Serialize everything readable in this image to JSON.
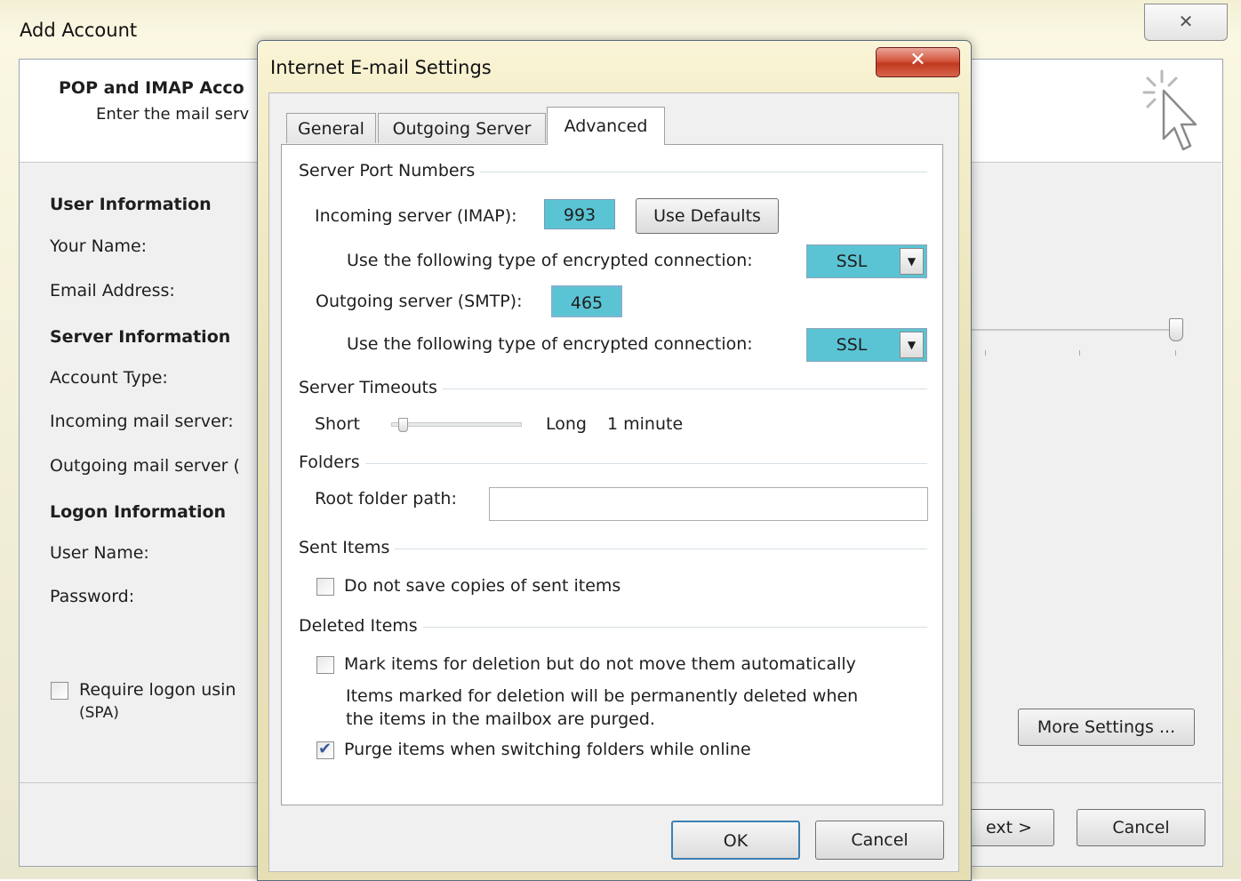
{
  "background_window": {
    "title": "Add Account",
    "close_glyph": "✕",
    "header": {
      "title": "POP and IMAP Acco",
      "subtitle": "Enter the mail serv"
    },
    "sections": {
      "user_info": "User Information",
      "server_info": "Server Information",
      "logon_info": "Logon Information"
    },
    "labels": {
      "your_name": "Your Name:",
      "email_address": "Email Address:",
      "account_type": "Account Type:",
      "incoming_server": "Incoming mail server:",
      "outgoing_server": "Outgoing mail server (",
      "user_name": "User Name:",
      "password": "Password:"
    },
    "require_logon": {
      "line1": "Require logon usin",
      "line2": "(SPA)",
      "checked": false
    },
    "buttons": {
      "more_settings": "More Settings ...",
      "next": "ext >",
      "cancel": "Cancel"
    }
  },
  "dialog": {
    "title": "Internet E-mail Settings",
    "close_glyph": "✕",
    "tabs": [
      {
        "label": "General",
        "active": false
      },
      {
        "label": "Outgoing Server",
        "active": false
      },
      {
        "label": "Advanced",
        "active": true
      }
    ],
    "server_ports": {
      "group_label": "Server Port Numbers",
      "incoming_label": "Incoming server (IMAP):",
      "incoming_port": "993",
      "use_defaults": "Use Defaults",
      "encryption_label": "Use the following type of encrypted connection:",
      "incoming_encryption": "SSL",
      "outgoing_label": "Outgoing server (SMTP):",
      "outgoing_port": "465",
      "outgoing_encryption": "SSL"
    },
    "timeouts": {
      "group_label": "Server Timeouts",
      "short_label": "Short",
      "long_label": "Long",
      "value_text": "1 minute",
      "slider_fraction": 0.1
    },
    "folders": {
      "group_label": "Folders",
      "root_label": "Root folder path:",
      "root_value": ""
    },
    "sent_items": {
      "group_label": "Sent Items",
      "do_not_save": "Do not save copies of sent items",
      "do_not_save_checked": false
    },
    "deleted_items": {
      "group_label": "Deleted Items",
      "mark_label": "Mark items for deletion but do not move them automatically",
      "mark_checked": false,
      "note_line1": "Items marked for deletion will be permanently deleted when",
      "note_line2": "the items in the mailbox are purged.",
      "purge_label": "Purge items when switching folders while online",
      "purge_checked": true
    },
    "buttons": {
      "ok": "OK",
      "cancel": "Cancel"
    },
    "colors": {
      "highlight": "#5bc4d4",
      "close_red": "#c0391f"
    }
  }
}
